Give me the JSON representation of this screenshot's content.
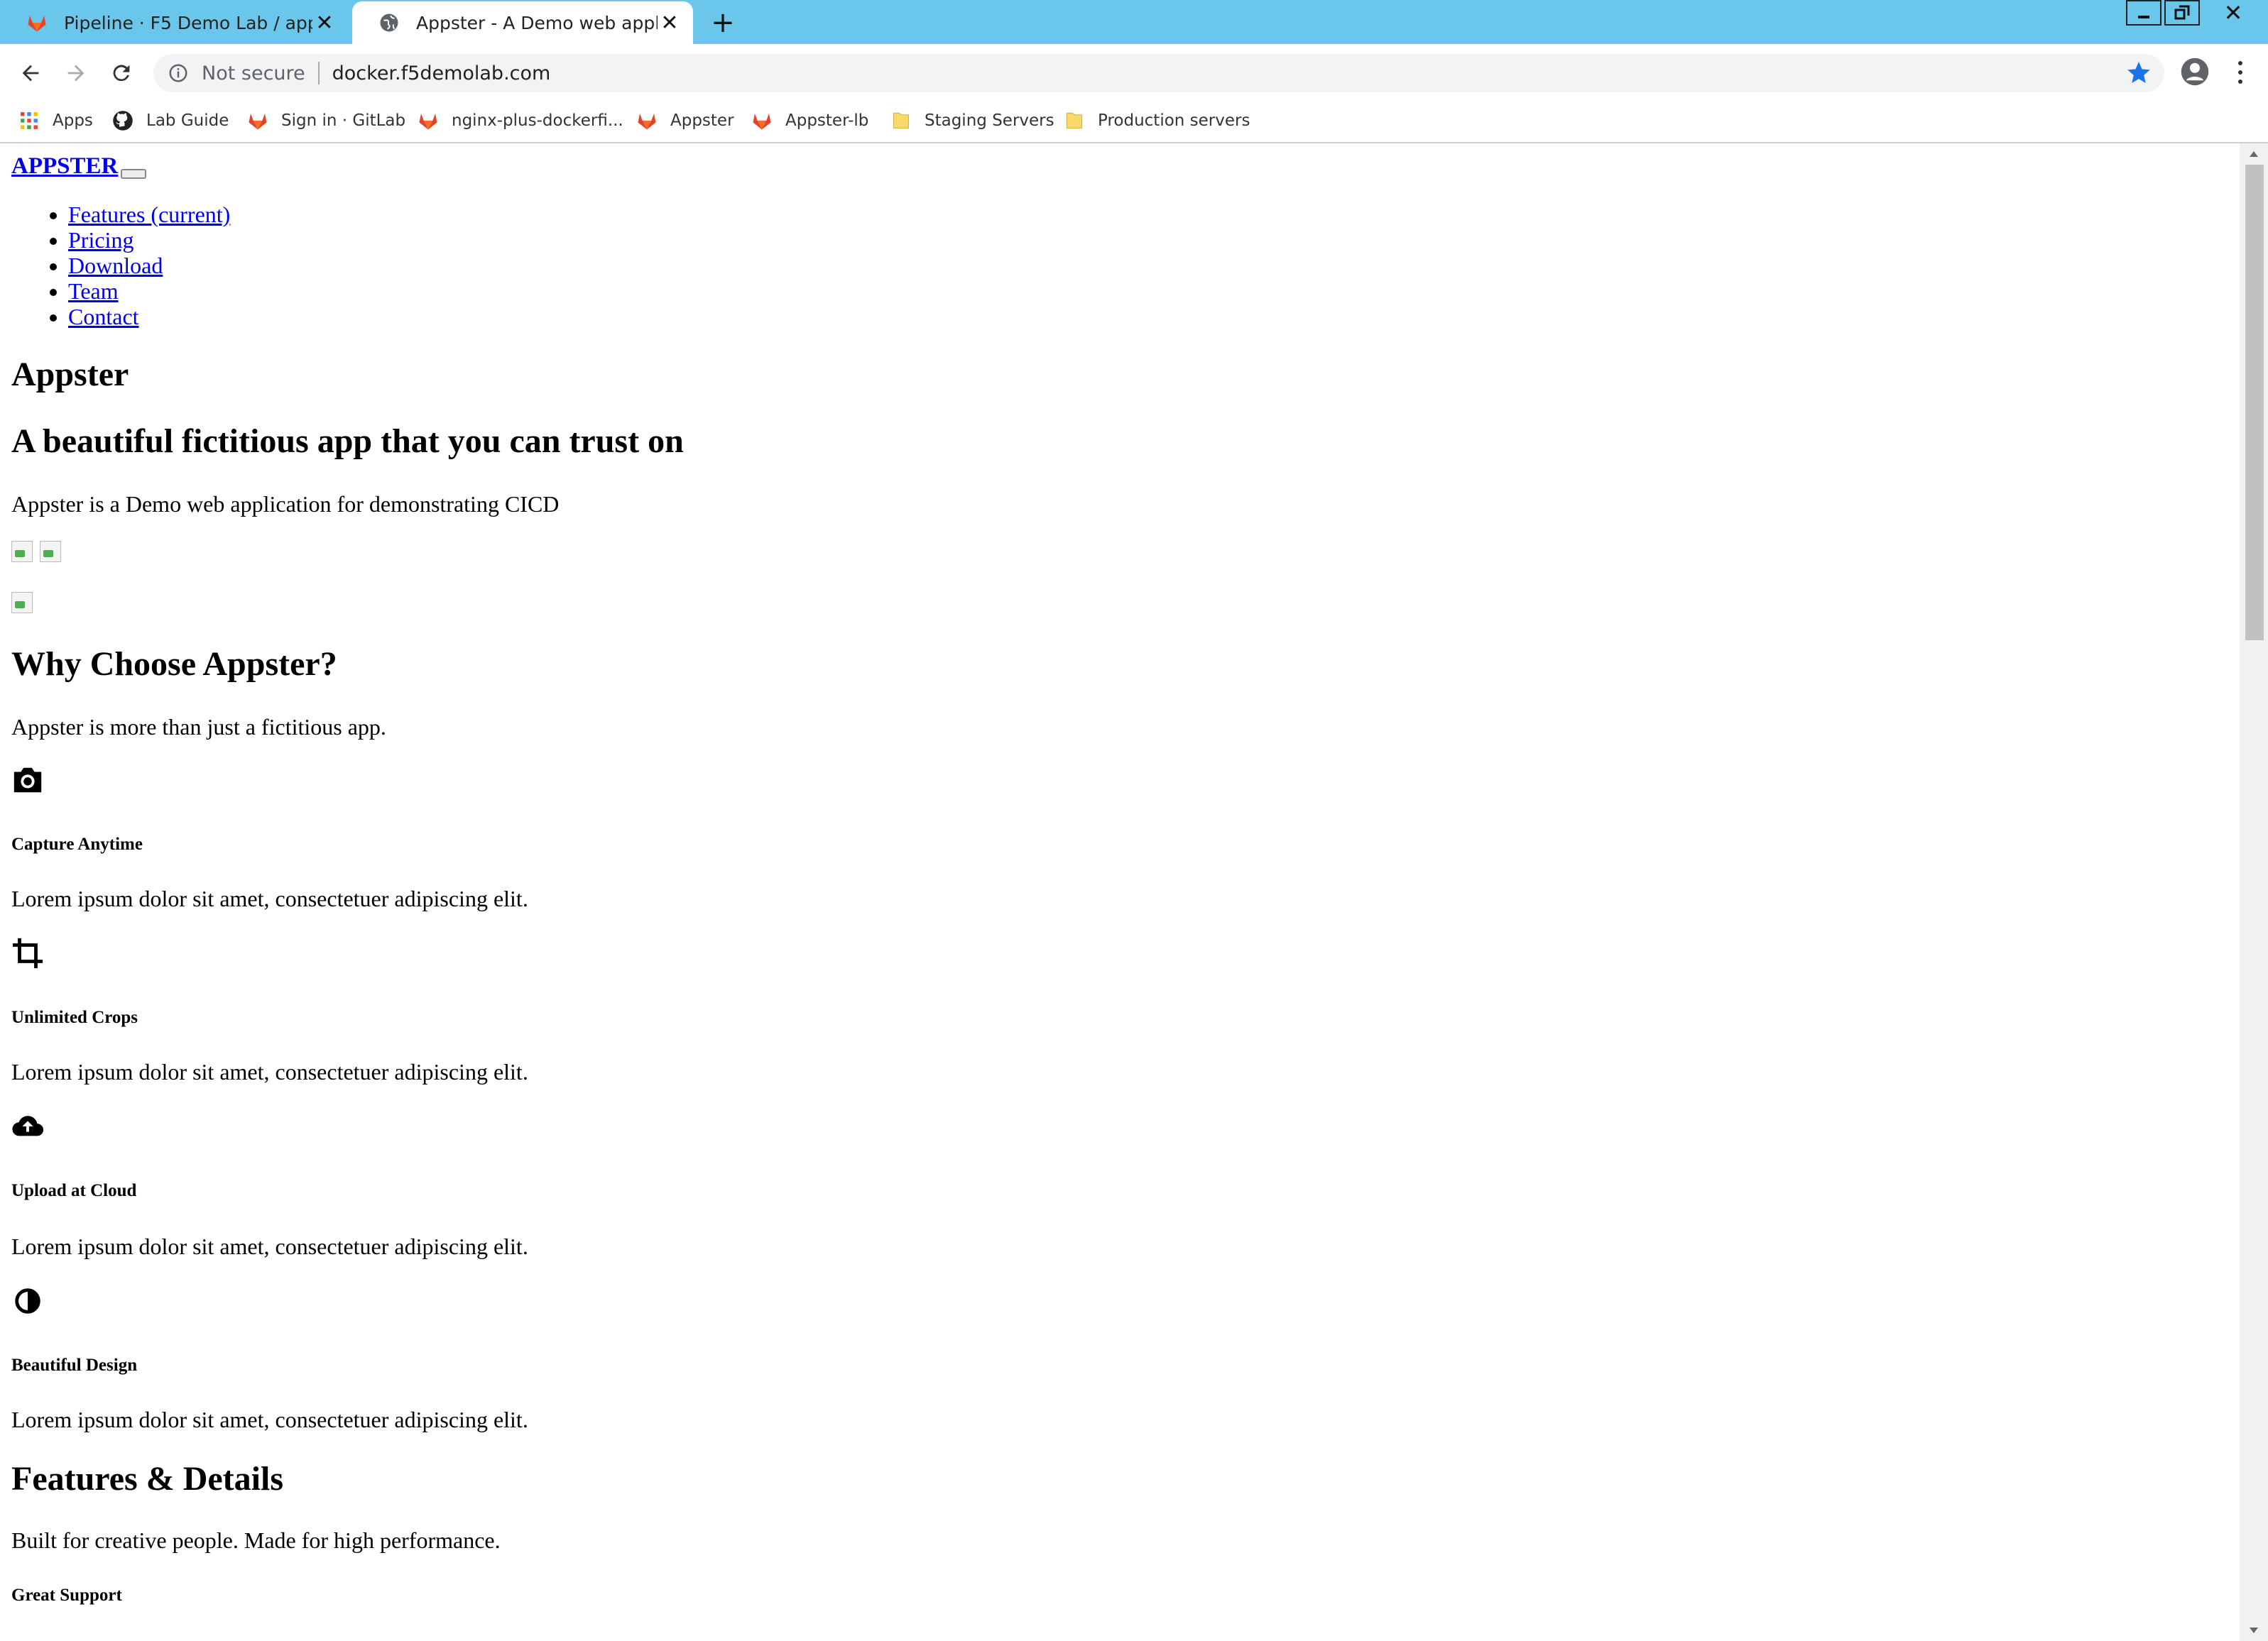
{
  "browser": {
    "tabs": [
      {
        "title": "Pipeline · F5 Demo Lab / appster",
        "active": false,
        "icon": "gitlab-icon"
      },
      {
        "title": "Appster - A Demo web application",
        "active": true,
        "icon": "globe-icon"
      }
    ],
    "new_tab_label": "+",
    "close_glyph": "✕",
    "omnibox": {
      "security": "Not secure",
      "url": "docker.f5demolab.com"
    },
    "bookmarks": [
      {
        "label": "Apps",
        "icon": "apps-grid-icon"
      },
      {
        "label": "Lab Guide",
        "icon": "github-icon"
      },
      {
        "label": "Sign in · GitLab",
        "icon": "gitlab-icon"
      },
      {
        "label": "nginx-plus-dockerfi...",
        "icon": "gitlab-icon"
      },
      {
        "label": "Appster",
        "icon": "gitlab-icon"
      },
      {
        "label": "Appster-lb",
        "icon": "gitlab-icon"
      },
      {
        "label": "Staging Servers",
        "icon": "folder-icon"
      },
      {
        "label": "Production servers",
        "icon": "folder-icon"
      }
    ],
    "colors": {
      "tabstrip": "#6ac6ea",
      "link": "#0000ee",
      "star": "#1a73e8",
      "gitlab": "#e24329"
    }
  },
  "page": {
    "brand": "APPSTER",
    "nav": [
      "Features (current)",
      "Pricing",
      "Download",
      "Team",
      "Contact"
    ],
    "title": "Appster",
    "tagline": "A beautiful fictitious app that you can trust on",
    "intro": "Appster is a Demo web application for demonstrating CICD",
    "why_heading": "Why Choose Appster?",
    "why_text": "Appster is more than just a fictitious app.",
    "features": [
      {
        "icon": "camera-icon",
        "title": "Capture Anytime",
        "text": "Lorem ipsum dolor sit amet, consectetuer adipiscing elit."
      },
      {
        "icon": "crop-icon",
        "title": "Unlimited Crops",
        "text": "Lorem ipsum dolor sit amet, consectetuer adipiscing elit."
      },
      {
        "icon": "cloud-upload-icon",
        "title": "Upload at Cloud",
        "text": "Lorem ipsum dolor sit amet, consectetuer adipiscing elit."
      },
      {
        "icon": "contrast-icon",
        "title": "Beautiful Design",
        "text": "Lorem ipsum dolor sit amet, consectetuer adipiscing elit."
      }
    ],
    "details_heading": "Features & Details",
    "details_text": "Built for creative people. Made for high performance.",
    "support_heading": "Great Support"
  }
}
